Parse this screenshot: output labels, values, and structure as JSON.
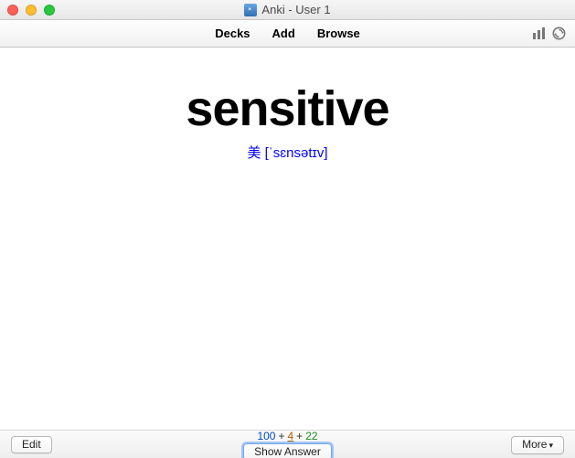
{
  "window": {
    "title": "Anki - User 1"
  },
  "toolbar": {
    "decks": "Decks",
    "add": "Add",
    "browse": "Browse"
  },
  "card": {
    "word": "sensitive",
    "reading": "美 [ˈsɛnsətɪv]"
  },
  "counts": {
    "new": "100",
    "learn": "4",
    "due": "22",
    "plus": "+"
  },
  "buttons": {
    "edit": "Edit",
    "show_answer": "Show Answer",
    "more": "More"
  }
}
